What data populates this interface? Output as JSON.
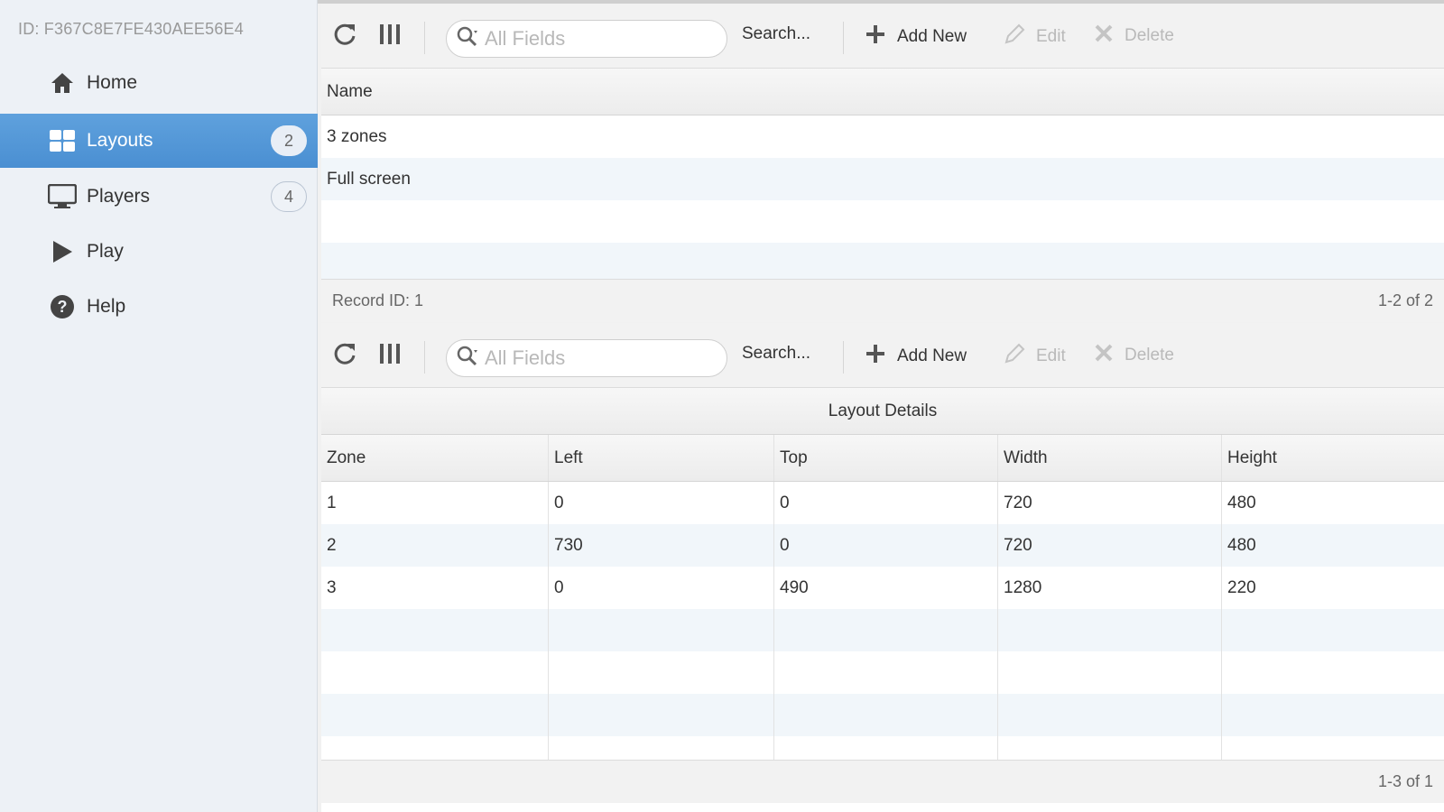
{
  "sidebar": {
    "device_id": "ID: F367C8E7FE430AEE56E4",
    "items": [
      {
        "label": "Home",
        "icon": "home-icon",
        "badge": ""
      },
      {
        "label": "Layouts",
        "icon": "layouts-icon",
        "badge": "2"
      },
      {
        "label": "Players",
        "icon": "monitor-icon",
        "badge": "4"
      },
      {
        "label": "Play",
        "icon": "play-icon",
        "badge": ""
      },
      {
        "label": "Help",
        "icon": "help-icon",
        "badge": ""
      }
    ],
    "active": "Layouts"
  },
  "layouts_grid": {
    "search_placeholder": "All Fields",
    "search_label": "Search...",
    "add_label": "Add New",
    "edit_label": "Edit",
    "delete_label": "Delete",
    "columns": [
      "Name"
    ],
    "rows": [
      [
        "3 zones"
      ],
      [
        "Full screen"
      ]
    ],
    "footer_left": "Record ID: 1",
    "footer_right": "1-2 of 2"
  },
  "details_grid": {
    "search_placeholder": "All Fields",
    "search_label": "Search...",
    "add_label": "Add New",
    "edit_label": "Edit",
    "delete_label": "Delete",
    "group_header": "Layout Details",
    "columns": [
      "Zone",
      "Left",
      "Top",
      "Width",
      "Height"
    ],
    "rows": [
      [
        "1",
        "0",
        "0",
        "720",
        "480"
      ],
      [
        "2",
        "730",
        "0",
        "720",
        "480"
      ],
      [
        "3",
        "0",
        "490",
        "1280",
        "220"
      ]
    ],
    "footer_right": "1-3 of 1"
  },
  "colors": {
    "active_nav": "#4a8fd2",
    "alt_row": "#f1f6fa",
    "sidebar_bg": "#edf1f6"
  }
}
